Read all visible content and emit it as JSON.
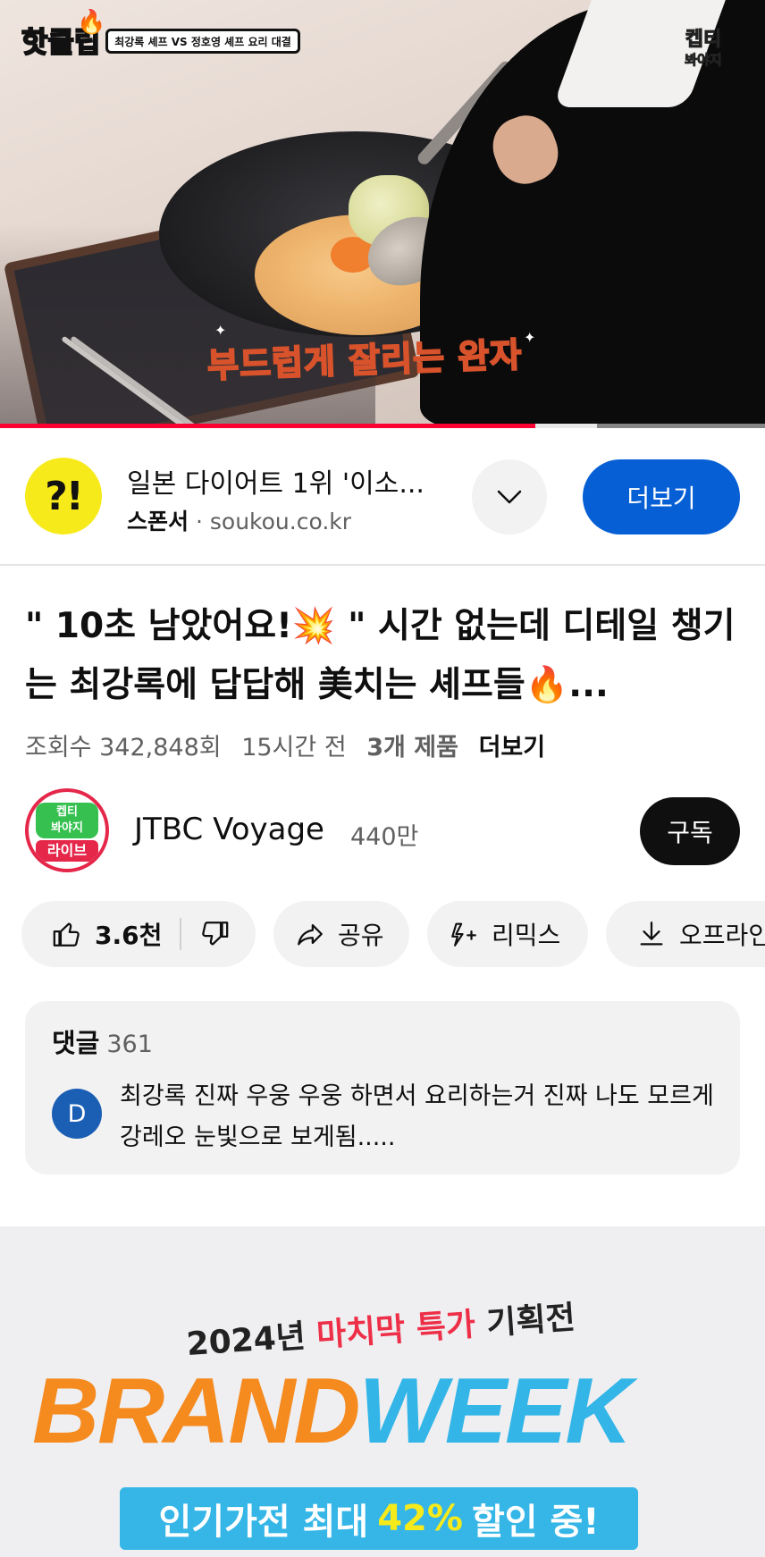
{
  "video": {
    "clip_logo_text": "핫클립",
    "clip_banner": "최강록 셰프 VS 정호영 셰프 요리 대결",
    "channel_watermark_line1": "켑티",
    "channel_watermark_line2": "봐야지",
    "subtitle": "부드럽게 잘리는 완자",
    "progress": 0.7
  },
  "ad": {
    "logo_text": "?!",
    "title": "일본 다이어트 1위 '이소...",
    "sponsor_label": "스폰서",
    "separator": "·",
    "domain": "soukou.co.kr",
    "cta_label": "더보기",
    "expand_icon": "chevron-down-icon"
  },
  "video_info": {
    "title": "\" 10초 남았어요!💥 \" 시간 없는데 디테일 챙기는 최강록에 답답해 美치는 셰프들🔥...",
    "views": "조회수 342,848회",
    "age": "15시간 전",
    "products": "3개 제품",
    "more": "더보기"
  },
  "channel": {
    "avatar_top": "켑티\n봐야지",
    "avatar_bottom": "라이브",
    "name": "JTBC Voyage",
    "subscribers": "440만",
    "subscribe_label": "구독"
  },
  "actions": {
    "likes": "3.6천",
    "share": "공유",
    "remix": "리믹스",
    "offline": "오프라인"
  },
  "comments": {
    "label": "댓글",
    "count": "361",
    "avatar_letter": "D",
    "top_comment": "최강록 진짜 우웅 우웅 하면서 요리하는거 진짜 나도 모르게 강레오 눈빛으로 보게됨....."
  },
  "banner": {
    "tagline_prefix": "2024년 ",
    "tagline_highlight": "마치막 특가",
    "tagline_suffix": " 기획전",
    "brand": "BRAND",
    "week": "WEEK",
    "promo_prefix": "인기가전 최대",
    "promo_highlight": "42%",
    "promo_suffix": "할인 중!"
  },
  "colors": {
    "accent_blue": "#065fd4",
    "progress_red": "#ff0033",
    "brand_orange": "#f58a1f",
    "week_blue": "#33b5e8"
  }
}
